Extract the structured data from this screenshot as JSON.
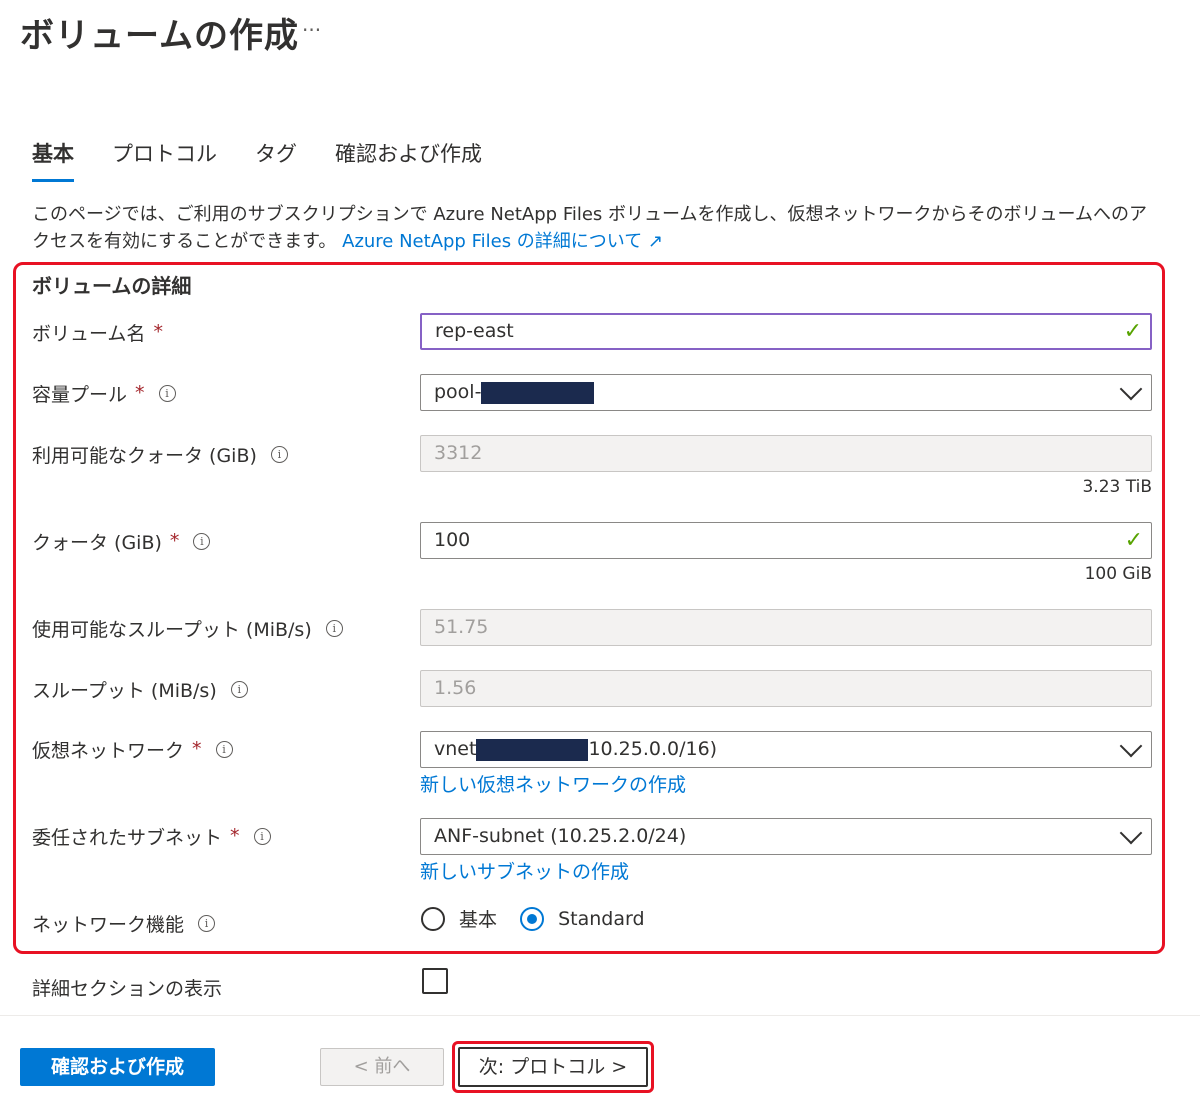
{
  "page": {
    "title": "ボリュームの作成",
    "more": "···"
  },
  "tabs": [
    {
      "label": "基本",
      "active": true
    },
    {
      "label": "プロトコル"
    },
    {
      "label": "タグ"
    },
    {
      "label": "確認および作成"
    }
  ],
  "description": {
    "text": "このページでは、ご利用のサブスクリプションで Azure NetApp Files ボリュームを作成し、仮想ネットワークからそのボリュームへのアクセスを有効にすることができます。",
    "link": "Azure NetApp Files の詳細について",
    "link_icon": "↗"
  },
  "section": {
    "title": "ボリュームの詳細"
  },
  "fields": {
    "volume_name": {
      "label": "ボリューム名",
      "value": "rep-east"
    },
    "capacity_pool": {
      "label": "容量プール",
      "value_prefix": "pool-"
    },
    "available_quota": {
      "label": "利用可能なクォータ (GiB)",
      "value": "3312",
      "sub": "3.23 TiB"
    },
    "quota": {
      "label": "クォータ (GiB)",
      "value": "100",
      "sub": "100 GiB"
    },
    "available_throughput": {
      "label": "使用可能なスループット (MiB/s)",
      "value": "51.75"
    },
    "throughput": {
      "label": "スループット (MiB/s)",
      "value": "1.56"
    },
    "vnet": {
      "label": "仮想ネットワーク",
      "value_prefix": "vnet",
      "value_suffix": "10.25.0.0/16)",
      "link": "新しい仮想ネットワークの作成"
    },
    "subnet": {
      "label": "委任されたサブネット",
      "value": "ANF-subnet (10.25.2.0/24)",
      "link": "新しいサブネットの作成"
    },
    "network_features": {
      "label": "ネットワーク機能",
      "options": [
        "基本",
        "Standard"
      ],
      "selected": "Standard"
    },
    "show_advanced": {
      "label": "詳細セクションの表示",
      "checked": false
    }
  },
  "required_mark": "*",
  "info_glyph": "i",
  "check_glyph": "✓",
  "buttons": {
    "review_create": "確認および作成",
    "prev": "< 前へ",
    "next": "次: プロトコル >"
  },
  "colors": {
    "accent": "#0078d4",
    "highlight": "#e81123",
    "valid": "#57a300"
  }
}
